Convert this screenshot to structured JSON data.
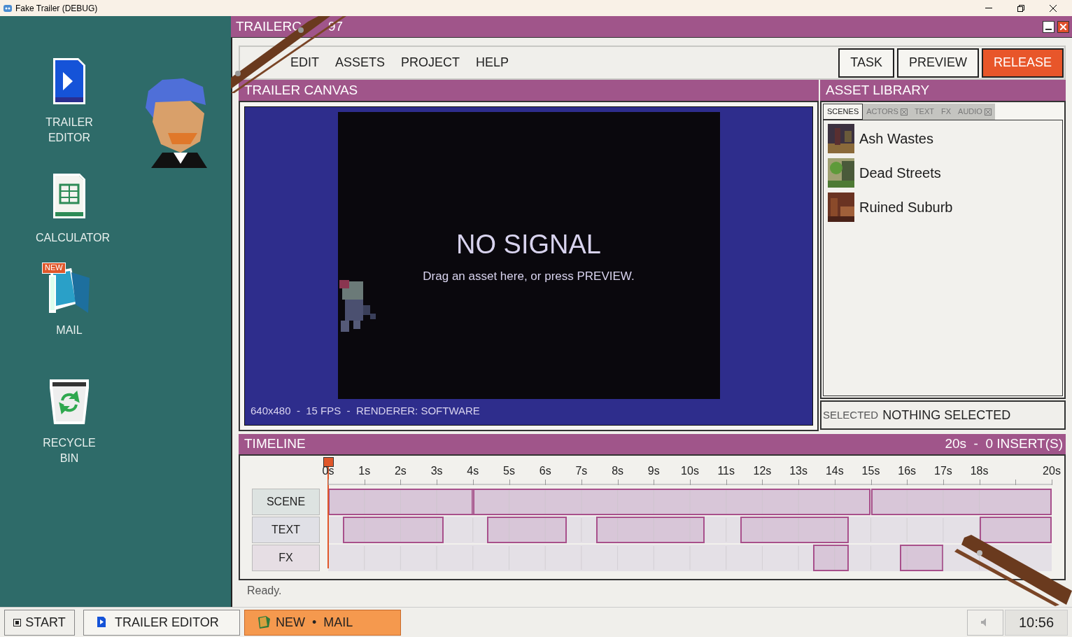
{
  "os_window": {
    "title": "Fake Trailer (DEBUG)"
  },
  "desktop_icons": [
    {
      "kind": "editor",
      "label": "TRAILER EDITOR"
    },
    {
      "kind": "calculator",
      "label": "CALCULATOR"
    },
    {
      "kind": "mail",
      "label": "MAIL",
      "badge": "NEW"
    },
    {
      "kind": "recycle",
      "label": "RECYCLE BIN"
    }
  ],
  "app_window": {
    "title_parts": [
      "TRAILERC",
      "97"
    ]
  },
  "menu": [
    "EDIT",
    "ASSETS",
    "PROJECT",
    "HELP"
  ],
  "toolbar_buttons": [
    {
      "label": "TASK",
      "kind": "default"
    },
    {
      "label": "PREVIEW",
      "kind": "default"
    },
    {
      "label": "RELEASE",
      "kind": "primary"
    }
  ],
  "canvas": {
    "title": "TRAILER CANVAS",
    "headline": "NO SIGNAL",
    "hint": "Drag an asset here, or press PREVIEW.",
    "info": "640x480  -  15 FPS  -  RENDERER: SOFTWARE"
  },
  "asset_library": {
    "title": "ASSET LIBRARY",
    "tabs": [
      {
        "label": "SCENES",
        "selected": true,
        "locked": false
      },
      {
        "label": "ACTORS",
        "selected": false,
        "locked": true
      },
      {
        "label": "TEXT",
        "selected": false,
        "locked": false
      },
      {
        "label": "FX",
        "selected": false,
        "locked": false
      },
      {
        "label": "AUDIO",
        "selected": false,
        "locked": true
      }
    ],
    "items": [
      {
        "name": "Ash Wastes",
        "kind": "ash"
      },
      {
        "name": "Dead Streets",
        "kind": "green"
      },
      {
        "name": "Ruined Suburb",
        "kind": "rust"
      }
    ],
    "selected_label": "SELECTED",
    "selected_value": "NOTHING SELECTED"
  },
  "timeline": {
    "title": "TIMELINE",
    "summary": "20s  -  0 INSERT(S)",
    "chart_data": {
      "type": "bar",
      "orientation": "horizontal",
      "stacked": true,
      "grid": true,
      "categories": [
        "SCENE",
        "TEXT",
        "FX"
      ],
      "xlim": [
        0,
        20
      ],
      "xticks": [
        {
          "value": 0,
          "label": "0s"
        },
        {
          "value": 1,
          "label": "1s"
        },
        {
          "value": 2,
          "label": "2s"
        },
        {
          "value": 3,
          "label": "3s"
        },
        {
          "value": 4,
          "label": "4s"
        },
        {
          "value": 5,
          "label": "5s"
        },
        {
          "value": 6,
          "label": "6s"
        },
        {
          "value": 7,
          "label": "7s"
        },
        {
          "value": 8,
          "label": "8s"
        },
        {
          "value": 9,
          "label": "9s"
        },
        {
          "value": 10,
          "label": "10s"
        },
        {
          "value": 11,
          "label": "11s"
        },
        {
          "value": 12,
          "label": "12s"
        },
        {
          "value": 13,
          "label": "13s"
        },
        {
          "value": 14,
          "label": "14s"
        },
        {
          "value": 15,
          "label": "15s"
        },
        {
          "value": 16,
          "label": "16s"
        },
        {
          "value": 17,
          "label": "17s"
        },
        {
          "value": 18,
          "label": "18s"
        },
        {
          "value": 20,
          "label": "20s"
        }
      ],
      "series": [
        {
          "color": "#e4e0e6",
          "values": [
            null,
            0.4,
            13.4
          ]
        },
        {
          "color": "#d8c6d8",
          "values": [
            4,
            2.8,
            1.0
          ]
        },
        {
          "color": "#e4e0e6",
          "values": [
            null,
            1.2,
            1.4
          ]
        },
        {
          "color": "#d8c6d8",
          "values": [
            11,
            2.2,
            1.2
          ]
        },
        {
          "color": "#e4e0e6",
          "values": [
            null,
            0.8,
            3.0
          ]
        },
        {
          "color": "#d8c6d8",
          "values": [
            5,
            3.0,
            null
          ]
        },
        {
          "color": "#e4e0e6",
          "values": [
            null,
            1.0,
            null
          ]
        },
        {
          "color": "#d8c6d8",
          "values": [
            null,
            3.0,
            null
          ]
        },
        {
          "color": "#e4e0e6",
          "values": [
            null,
            3.6,
            null
          ]
        },
        {
          "color": "#d8c6d8",
          "values": [
            null,
            2.0,
            null
          ]
        }
      ]
    }
  },
  "status": "Ready.",
  "taskbar": {
    "start": "START",
    "tasks": [
      {
        "label": "TRAILER EDITOR",
        "kind": "editor",
        "selected": false
      },
      {
        "label": "NEW  •  MAIL",
        "kind": "mail",
        "selected": true
      }
    ],
    "clock": "10:56"
  }
}
